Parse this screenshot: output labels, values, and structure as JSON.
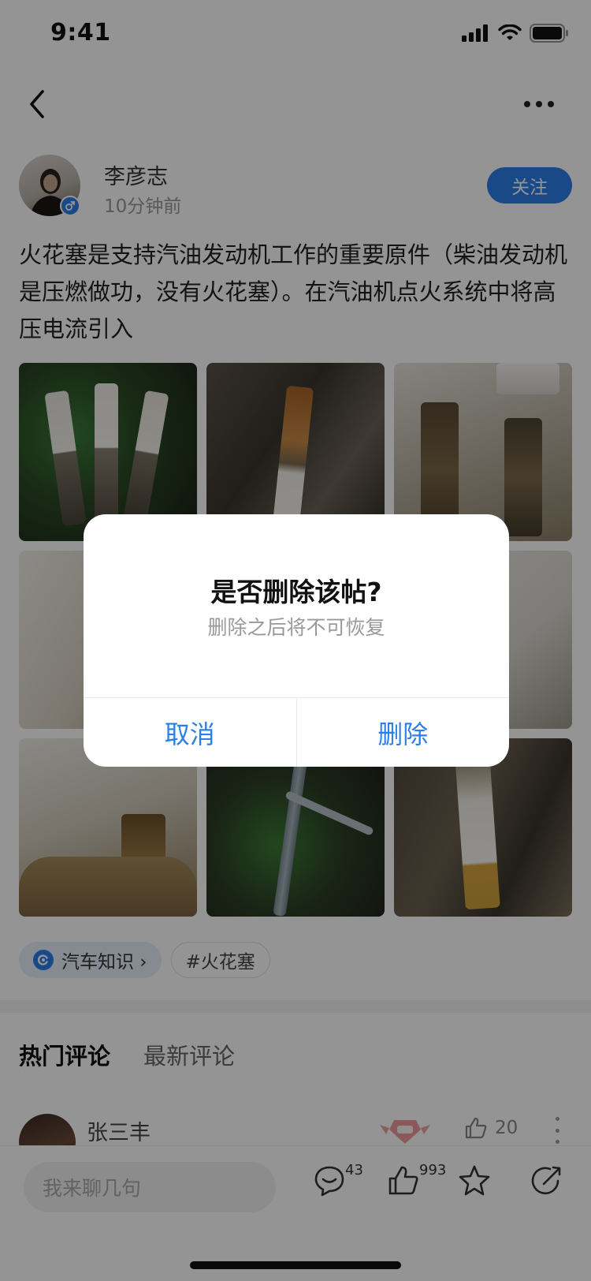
{
  "status_bar": {
    "time": "9:41"
  },
  "author": {
    "name": "李彦志",
    "time": "10分钟前",
    "follow_label": "关注"
  },
  "post": {
    "text": "火花塞是支持汽油发动机工作的重要原件（柴油发动机是压燃做功，没有火花塞）。在汽油机点火系统中将高压电流引入",
    "image_count": 9
  },
  "tags": {
    "topic": "汽车知识 ›",
    "hashtag": "#火花塞"
  },
  "comments": {
    "tab_hot": "热门评论",
    "tab_new": "最新评论",
    "first": {
      "name": "张三丰",
      "like_count": "20"
    }
  },
  "bottom_bar": {
    "input_placeholder": "我来聊几句",
    "comment_count": "43",
    "like_count": "993"
  },
  "dialog": {
    "title": "是否删除该帖?",
    "subtitle": "删除之后将不可恢复",
    "cancel_label": "取消",
    "confirm_label": "删除"
  },
  "colors": {
    "accent": "#2b7fe9",
    "overlay": "rgba(0,0,0,0.42)"
  }
}
